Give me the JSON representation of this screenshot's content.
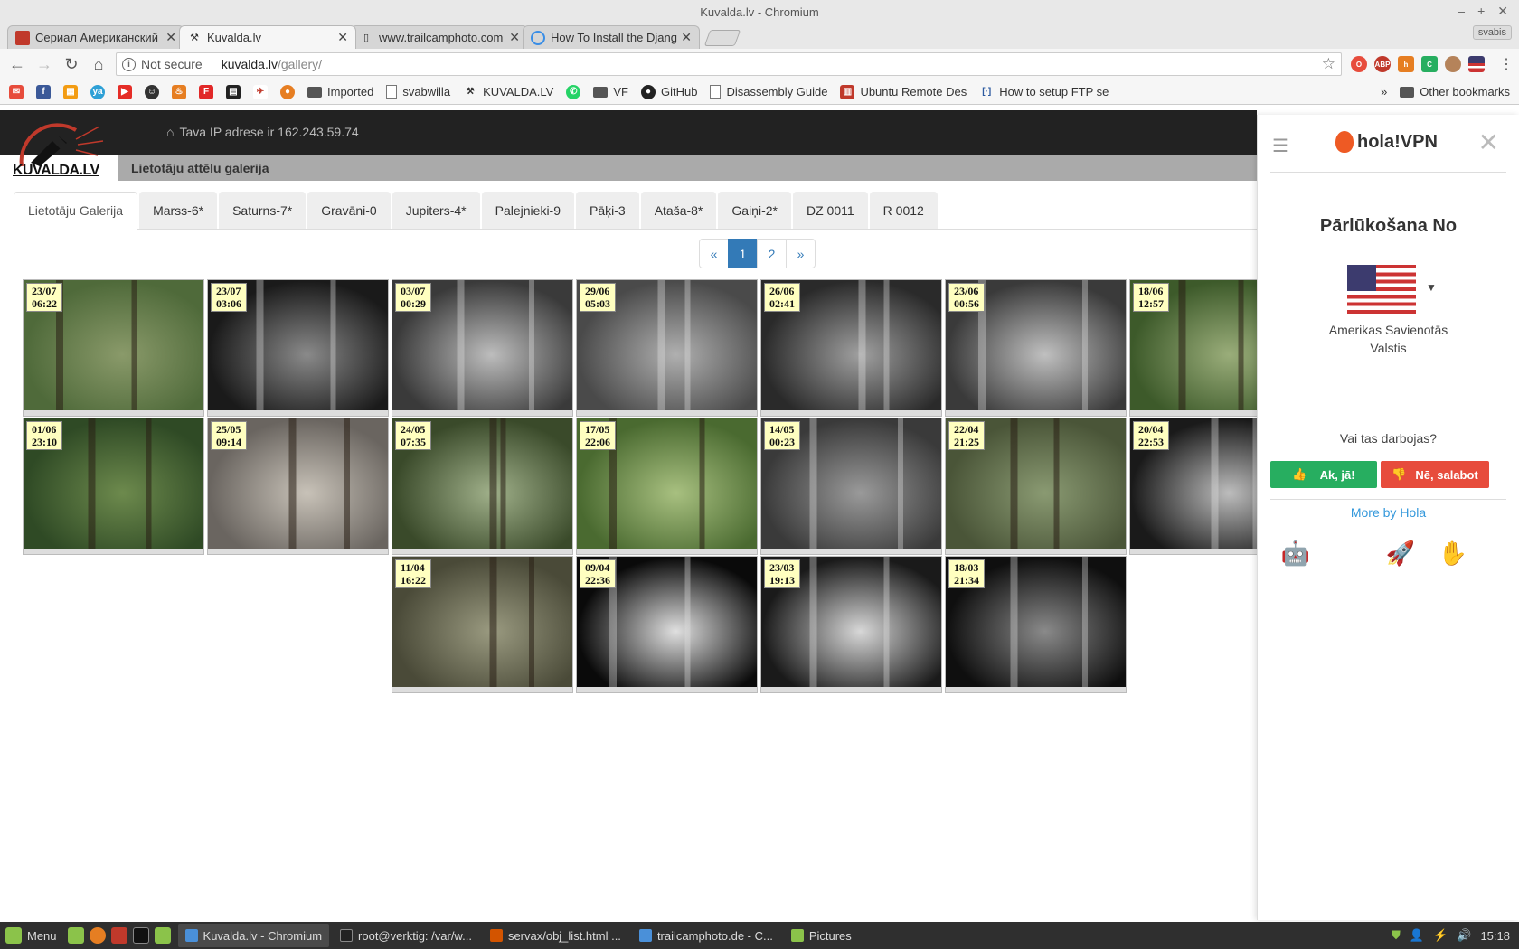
{
  "window": {
    "title": "Kuvalda.lv - Chromium"
  },
  "tabs": [
    {
      "label": "Сериал Американский",
      "active": false
    },
    {
      "label": "Kuvalda.lv",
      "active": true
    },
    {
      "label": "www.trailcamphoto.com",
      "active": false
    },
    {
      "label": "How To Install the Djang",
      "active": false
    }
  ],
  "profile": "svabis",
  "toolbar": {
    "security_label": "Not secure",
    "url_host": "kuvalda.lv",
    "url_path": "/gallery/"
  },
  "bookmarks": {
    "items": [
      {
        "label": "Imported",
        "icon": "folder-icon"
      },
      {
        "label": "svabwilla",
        "icon": "page-icon"
      },
      {
        "label": "KUVALDA.LV",
        "icon": "kuvalda-icon"
      },
      {
        "label": "VF",
        "icon": "folder-icon"
      },
      {
        "label": "GitHub",
        "icon": "github-icon"
      },
      {
        "label": "Disassembly Guide",
        "icon": "page-icon"
      },
      {
        "label": "Ubuntu Remote Des",
        "icon": "ubuntu-icon"
      },
      {
        "label": "How to setup FTP se",
        "icon": "page-icon"
      }
    ],
    "overflow": "»",
    "other": "Other bookmarks"
  },
  "site": {
    "logo_text": "KUVALDA.LV",
    "ip_text": "Tava IP adrese ir 162.243.59.74",
    "subheader": "Lietotāju attēlu galerija",
    "nav_tabs": [
      {
        "label": "Lietotāju Galerija",
        "active": true
      },
      {
        "label": "Marss-6*"
      },
      {
        "label": "Saturns-7*"
      },
      {
        "label": "Gravāni-0"
      },
      {
        "label": "Jupiters-4*"
      },
      {
        "label": "Palejnieki-9"
      },
      {
        "label": "Pāķi-3"
      },
      {
        "label": "Ataša-8*"
      },
      {
        "label": "Gaiņi-2*"
      },
      {
        "label": "DZ 0011"
      },
      {
        "label": "R 0012"
      }
    ],
    "pagination": {
      "prev": "«",
      "pages": [
        "1",
        "2"
      ],
      "current": "1",
      "next": "»"
    }
  },
  "photos": [
    {
      "date": "23/07",
      "time": "06:22",
      "tone": "color",
      "c1": "#4f6a3a",
      "c2": "#8a9a6a"
    },
    {
      "date": "23/07",
      "time": "03:06",
      "tone": "night",
      "c1": "#1a1a1a",
      "c2": "#8a8a8a"
    },
    {
      "date": "03/07",
      "time": "00:29",
      "tone": "night",
      "c1": "#3a3a3a",
      "c2": "#bdbdbd"
    },
    {
      "date": "29/06",
      "time": "05:03",
      "tone": "night",
      "c1": "#4a4a4a",
      "c2": "#b0b0b0"
    },
    {
      "date": "26/06",
      "time": "02:41",
      "tone": "night",
      "c1": "#2a2a2a",
      "c2": "#a0a0a0"
    },
    {
      "date": "23/06",
      "time": "00:56",
      "tone": "night",
      "c1": "#3a3a3a",
      "c2": "#c0c0c0"
    },
    {
      "date": "18/06",
      "time": "12:57",
      "tone": "color",
      "c1": "#3d5a2a",
      "c2": "#9aad7a"
    },
    {
      "date": "01/06",
      "time": "23:10",
      "tone": "color",
      "c1": "#2f4a25",
      "c2": "#6d8a4d"
    },
    {
      "date": "25/05",
      "time": "09:14",
      "tone": "color",
      "c1": "#6a6560",
      "c2": "#c8c2b8"
    },
    {
      "date": "24/05",
      "time": "07:35",
      "tone": "color",
      "c1": "#3a4a2a",
      "c2": "#a0b08a"
    },
    {
      "date": "17/05",
      "time": "22:06",
      "tone": "color",
      "c1": "#4a6a30",
      "c2": "#a8c080"
    },
    {
      "date": "14/05",
      "time": "00:23",
      "tone": "night",
      "c1": "#3a3a3a",
      "c2": "#9a9a9a"
    },
    {
      "date": "22/04",
      "time": "21:25",
      "tone": "color",
      "c1": "#4a5538",
      "c2": "#8a9a72"
    },
    {
      "date": "20/04",
      "time": "22:53",
      "tone": "night",
      "c1": "#1a1a1a",
      "c2": "#bdbdbd"
    },
    {
      "date": "11/04",
      "time": "16:22",
      "tone": "color",
      "c1": "#4a4a38",
      "c2": "#9a9a80"
    },
    {
      "date": "09/04",
      "time": "22:36",
      "tone": "night",
      "c1": "#0a0a0a",
      "c2": "#e0e0e0"
    },
    {
      "date": "23/03",
      "time": "19:13",
      "tone": "night",
      "c1": "#1a1a1a",
      "c2": "#d8d8d8"
    },
    {
      "date": "18/03",
      "time": "21:34",
      "tone": "night",
      "c1": "#0f0f0f",
      "c2": "#8a8a8a"
    }
  ],
  "hola": {
    "brand": "hola!VPN",
    "title": "Pārlūkošana No",
    "country_line1": "Amerikas Savienotās",
    "country_line2": "Valstis",
    "question": "Vai tas darbojas?",
    "yes_label": "Ak, jā!",
    "no_label": "Nē, salabot",
    "more_label": "More by Hola",
    "apps": [
      "android-icon",
      "apple-icon",
      "rocket-icon",
      "hand-icon"
    ]
  },
  "taskbar": {
    "menu_label": "Menu",
    "items": [
      {
        "label": "Kuvalda.lv - Chromium",
        "active": true,
        "color": "#4a90d9"
      },
      {
        "label": "root@verktig: /var/w...",
        "active": false,
        "color": "#222"
      },
      {
        "label": "servax/obj_list.html ...",
        "active": false,
        "color": "#d35400"
      },
      {
        "label": "trailcamphoto.de - C...",
        "active": false,
        "color": "#4a90d9"
      },
      {
        "label": "Pictures",
        "active": false,
        "color": "#8bc34a"
      }
    ],
    "clock": "15:18"
  }
}
